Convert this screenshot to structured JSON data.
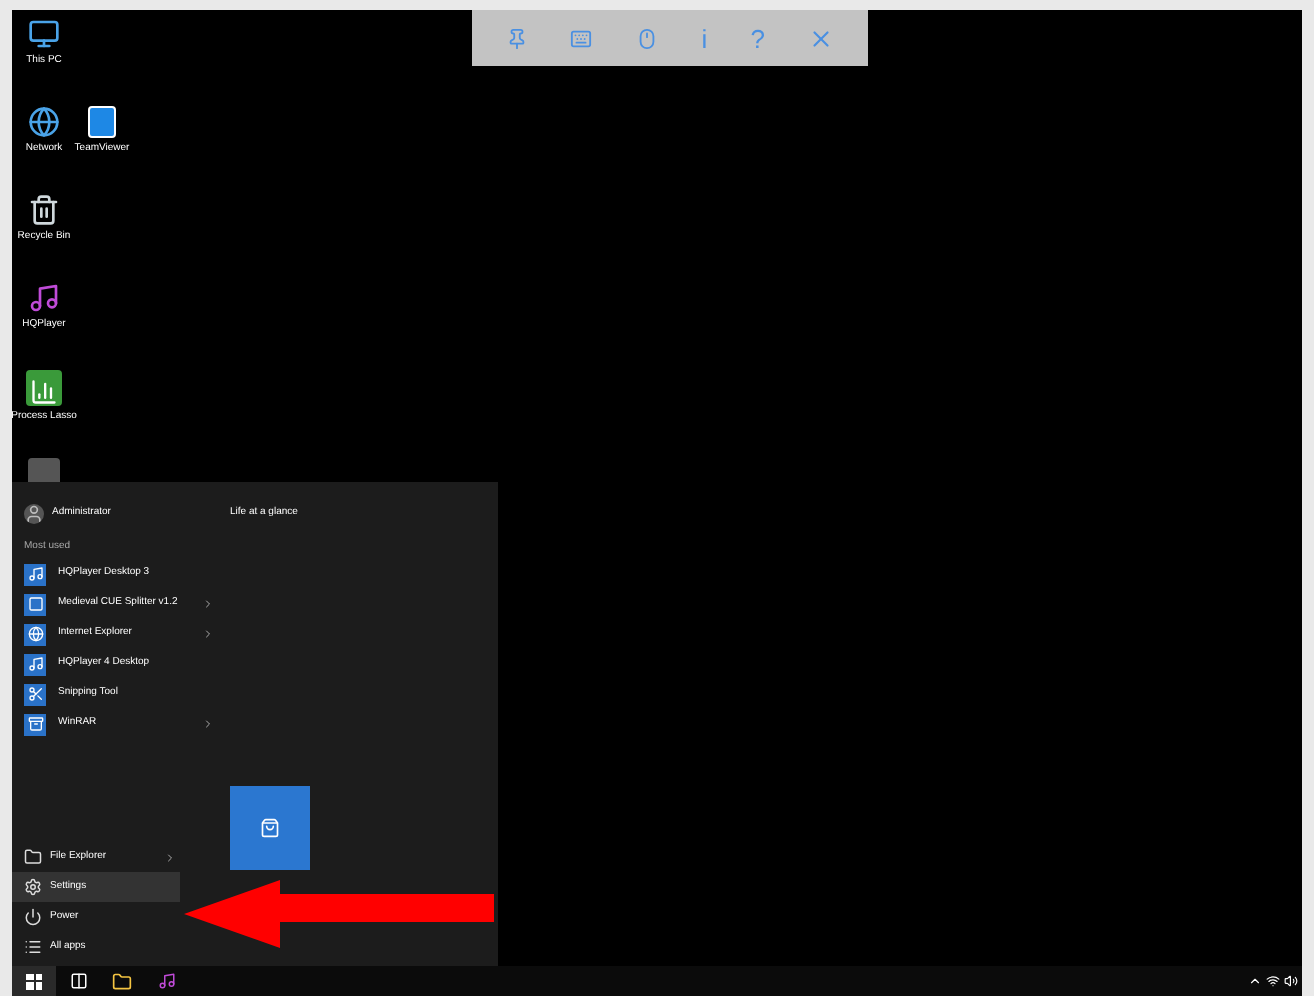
{
  "remote_toolbar": {
    "items": [
      {
        "kind": "pin"
      },
      {
        "kind": "keyboard"
      },
      {
        "kind": "mouse"
      },
      {
        "kind": "text",
        "text": "i"
      },
      {
        "kind": "text",
        "text": "?"
      },
      {
        "kind": "close"
      }
    ]
  },
  "desktop_icons": [
    {
      "kind": "computer",
      "label": "This PC"
    },
    {
      "kind": "network",
      "label": "Network",
      "neighbor": {
        "kind": "teamviewer",
        "label": "TeamViewer"
      }
    },
    {
      "kind": "recycle",
      "label": "Recycle Bin"
    },
    {
      "kind": "hqplayer",
      "label": "HQPlayer"
    },
    {
      "kind": "lasso",
      "label": "Process Lasso"
    },
    {
      "kind": "partial"
    }
  ],
  "start_menu": {
    "user": "Administrator",
    "most_used_label": "Most used",
    "most_used": [
      {
        "kind": "hqplayer",
        "label": "HQPlayer Desktop 3",
        "has_submenu": false
      },
      {
        "kind": "cue",
        "label": "Medieval CUE Splitter v1.2",
        "has_submenu": true
      },
      {
        "kind": "ie",
        "label": "Internet Explorer",
        "has_submenu": true
      },
      {
        "kind": "hqplayer",
        "label": "HQPlayer 4 Desktop",
        "has_submenu": false
      },
      {
        "kind": "snip",
        "label": "Snipping Tool",
        "has_submenu": false
      },
      {
        "kind": "rar",
        "label": "WinRAR",
        "has_submenu": true
      }
    ],
    "bottom": [
      {
        "kind": "explorer",
        "label": "File Explorer",
        "has_submenu": true,
        "selected": false
      },
      {
        "kind": "settings",
        "label": "Settings",
        "has_submenu": false,
        "selected": true
      },
      {
        "kind": "power",
        "label": "Power",
        "has_submenu": false,
        "selected": false
      },
      {
        "kind": "apps",
        "label": "All apps",
        "has_submenu": false,
        "selected": false
      }
    ],
    "tiles_heading": "Life at a glance",
    "tiles": [
      {
        "kind": "store"
      }
    ]
  },
  "taskbar": {
    "items": [
      {
        "kind": "start"
      },
      {
        "kind": "taskview"
      },
      {
        "kind": "folder"
      },
      {
        "kind": "hqplayer"
      }
    ],
    "tray": [
      {
        "kind": "chevron"
      },
      {
        "kind": "network"
      },
      {
        "kind": "volume"
      }
    ]
  }
}
